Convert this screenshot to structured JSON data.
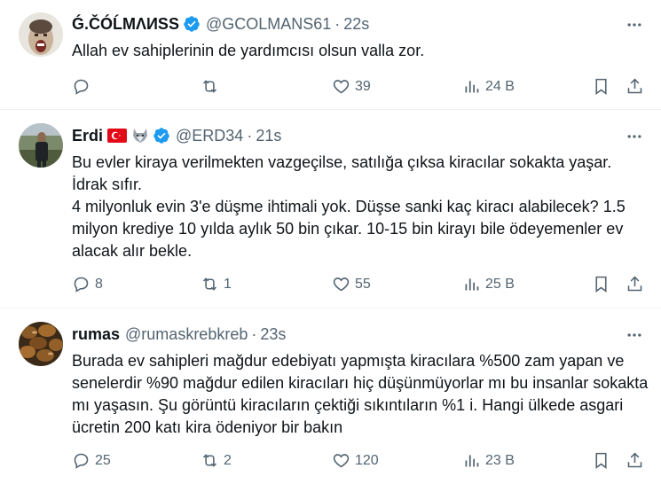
{
  "tweets": [
    {
      "name": "Ǵ.ČÓĹMΛИSS",
      "handle": "@GCOLMANS61",
      "time": "22s",
      "text": "Allah ev sahiplerinin de yardımcısı olsun valla zor.",
      "replies": "",
      "retweets": "",
      "likes": "39",
      "views": "24 B",
      "verified": true,
      "flags": []
    },
    {
      "name": "Erdi",
      "handle": "@ERD34",
      "time": "21s",
      "text": "Bu evler kiraya verilmekten vazgeçilse, satılığa çıksa kiracılar sokakta yaşar. İdrak sıfır.\n4 milyonluk evin 3'e düşme ihtimali yok. Düşse sanki kaç kiracı alabilecek? 1.5 milyon krediye 10 yılda aylık 50 bin çıkar. 10-15 bin kirayı bile ödeyemenler ev alacak alır bekle.",
      "replies": "8",
      "retweets": "1",
      "likes": "55",
      "views": "25 B",
      "verified": true,
      "flags": [
        "turkey-flag-icon",
        "wolf-icon"
      ]
    },
    {
      "name": "rumas",
      "handle": "@rumaskrebkreb",
      "time": "23s",
      "text": "Burada ev sahipleri mağdur edebiyatı yapmışta kiracılara %500 zam yapan ve senelerdir %90 mağdur edilen kiracıları hiç düşünmüyorlar mı bu insanlar sokakta mı yaşasın. Şu görüntü kiracıların çektiği sıkıntıların %1 i. Hangi ülkede asgari ücretin 200 katı kira ödeniyor bir bakın",
      "replies": "25",
      "retweets": "2",
      "likes": "120",
      "views": "23 B",
      "verified": false,
      "flags": []
    }
  ],
  "colors": {
    "verified": "#1d9bf0",
    "muted": "#536471",
    "text": "#0f1419",
    "border": "#eff3f4"
  },
  "separator": "·"
}
